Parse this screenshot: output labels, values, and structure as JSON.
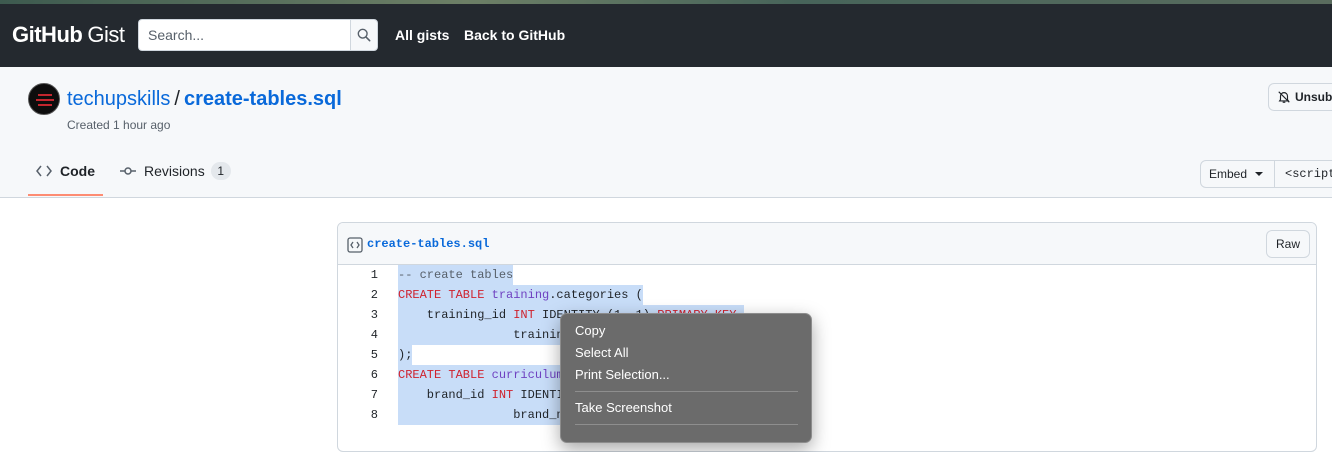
{
  "header": {
    "logo_bold": "GitHub",
    "logo_light": "Gist",
    "search_placeholder": "Search...",
    "nav": [
      "All gists",
      "Back to GitHub"
    ]
  },
  "gist": {
    "owner": "techupskills",
    "separator": "/",
    "filename": "create-tables.sql",
    "meta": "Created 1 hour ago",
    "unsubscribe_label": "Unsub",
    "tabs": [
      {
        "label": "Code"
      },
      {
        "label": "Revisions",
        "count": "1"
      }
    ],
    "embed_label": "Embed",
    "embed_value": "<script src=\"",
    "raw_label": "Raw"
  },
  "code_lines": [
    {
      "n": "1"
    },
    {
      "n": "2"
    },
    {
      "n": "3"
    },
    {
      "n": "4"
    },
    {
      "n": "5"
    },
    {
      "n": "6"
    },
    {
      "n": "7"
    },
    {
      "n": "8"
    }
  ],
  "code_text": {
    "l1": "-- create tables",
    "l2_kw": "CREATE TABLE",
    "l2_schema": "training",
    "l2_rest": ".categories (",
    "l3_a": "    training_id ",
    "l3_kw": "INT",
    "l3_b": " IDENTITY (1, 1) ",
    "l3_pk": "PRIMARY KEY,",
    "l4": "                training_",
    "l5": ");",
    "l6_kw": "CREATE TABLE",
    "l6_rest": "curriculum",
    "l7_a": "    brand_id ",
    "l7_kw": "INT",
    "l7_b": " IDENTI",
    "l8": "                brand_na"
  },
  "context_menu": {
    "items": [
      "Copy",
      "Select All",
      "Print Selection...",
      "Take Screenshot"
    ]
  },
  "colors": {
    "header_bg": "#24292f",
    "link": "#0969da",
    "keyword": "#cf222e",
    "entity": "#6f42c1",
    "selection": "#c8ddf8",
    "active_tab_underline": "#fd8c73",
    "menu_bg": "#6b6b6b"
  },
  "icons": [
    "search-icon",
    "bell-slash-icon",
    "code-icon",
    "git-commit-icon",
    "file-code-icon",
    "triangle-down-icon"
  ]
}
